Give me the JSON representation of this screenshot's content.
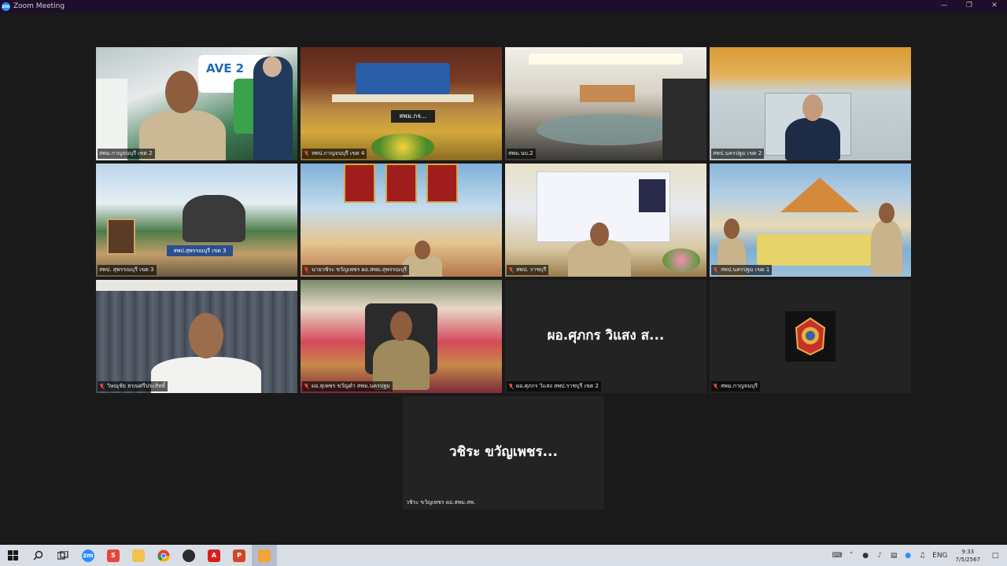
{
  "window": {
    "title": "Zoom Meeting",
    "app_icon": "zoom-icon",
    "controls": [
      "minimize-icon",
      "restore-icon",
      "close-icon"
    ]
  },
  "tiles": [
    {
      "label": "สพม.กาญจนบุรี เขต 2",
      "muted": false
    },
    {
      "label": "สพป.กาญจนบุรี เขต 4",
      "muted": true,
      "overlay_text": "สพม.กจ..."
    },
    {
      "label": "สพม.นบ.2",
      "muted": false
    },
    {
      "label": "สพป.นครปฐม เขต 2",
      "muted": false
    },
    {
      "label": "สพป. สุพรรณบุรี เขต 3",
      "muted": false,
      "overlay_text": "สพป.สุพรรณบุรี เขต 3"
    },
    {
      "label": "นายวชิระ ขวัญเพชร ผอ.สพม.สุพรรณบุรี",
      "muted": true
    },
    {
      "label": "สพป. ราชบุรี",
      "muted": true
    },
    {
      "label": "สพป.นครปฐม เขต 1",
      "muted": true
    },
    {
      "label": "วิษณุชัย ธรณศรีประสิทธิ์",
      "muted": true
    },
    {
      "label": "ผอ.สุเพชร ขวัญดำ สพม.นครปฐม",
      "muted": true
    },
    {
      "label": "ผอ.ศุภกร วิแสง สพป.ราชบุรี เขต 2",
      "muted": true,
      "big_name": "ผอ.ศุภกร วิแสง ส..."
    },
    {
      "label": "สพม.กาญจนบุรี",
      "muted": true
    },
    {
      "label": "วชิระ ขวัญเพชร ผอ.สพม.สพ.",
      "muted": false,
      "big_name": "วชิระ ขวัญเพชร..."
    }
  ],
  "taskbar": {
    "items": [
      "windows-start-icon",
      "search-icon",
      "task-view-icon",
      "zoom-app-icon",
      "wps-icon",
      "file-explorer-icon",
      "chrome-icon",
      "app-icon",
      "acrobat-icon",
      "powerpoint-icon",
      "notes-icon"
    ],
    "language": "ENG",
    "time": "9:33",
    "date": "7/5/2567"
  },
  "colors": {
    "titlebar": "#1d0f2b",
    "stage": "#1a1a1a",
    "active_border": "#b8d636",
    "taskbar": "#d9dde6"
  }
}
